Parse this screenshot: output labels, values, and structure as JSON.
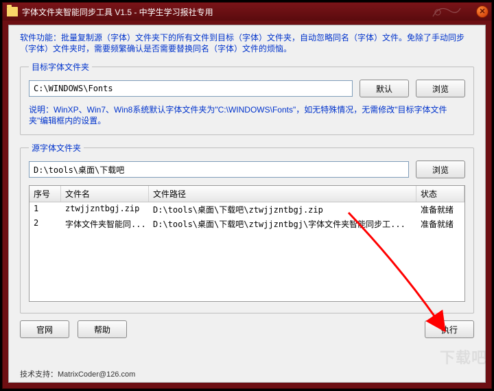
{
  "title": "字体文件夹智能同步工具 V1.5 - 中学生学习报社专用",
  "description": "软件功能：批量复制源（字体）文件夹下的所有文件到目标（字体）文件夹，自动忽略同名（字体）文件。免除了手动同步（字体）文件夹时，需要频繁确认是否需要替换同名（字体）文件的烦恼。",
  "target_group": {
    "legend": "目标字体文件夹",
    "path": "C:\\WINDOWS\\Fonts",
    "default_btn": "默认",
    "browse_btn": "浏览",
    "note": "说明：WinXP、Win7、Win8系统默认字体文件夹为\"C:\\WINDOWS\\Fonts\"，如无特殊情况，无需修改\"目标字体文件夹\"编辑框内的设置。"
  },
  "source_group": {
    "legend": "源字体文件夹",
    "path": "D:\\tools\\桌面\\下载吧",
    "browse_btn": "浏览",
    "columns": {
      "idx": "序号",
      "name": "文件名",
      "path": "文件路径",
      "status": "状态"
    },
    "rows": [
      {
        "idx": "1",
        "name": "ztwjjzntbgj.zip",
        "path": "D:\\tools\\桌面\\下载吧\\ztwjjzntbgj.zip",
        "status": "准备就绪"
      },
      {
        "idx": "2",
        "name": "字体文件夹智能同...",
        "path": "D:\\tools\\桌面\\下载吧\\ztwjjzntbgj\\字体文件夹智能同步工...",
        "status": "准备就绪"
      }
    ]
  },
  "buttons": {
    "website": "官网",
    "help": "帮助",
    "execute": "执行"
  },
  "footer": "技术支持：MatrixCoder@126.com",
  "watermark": "下载吧"
}
